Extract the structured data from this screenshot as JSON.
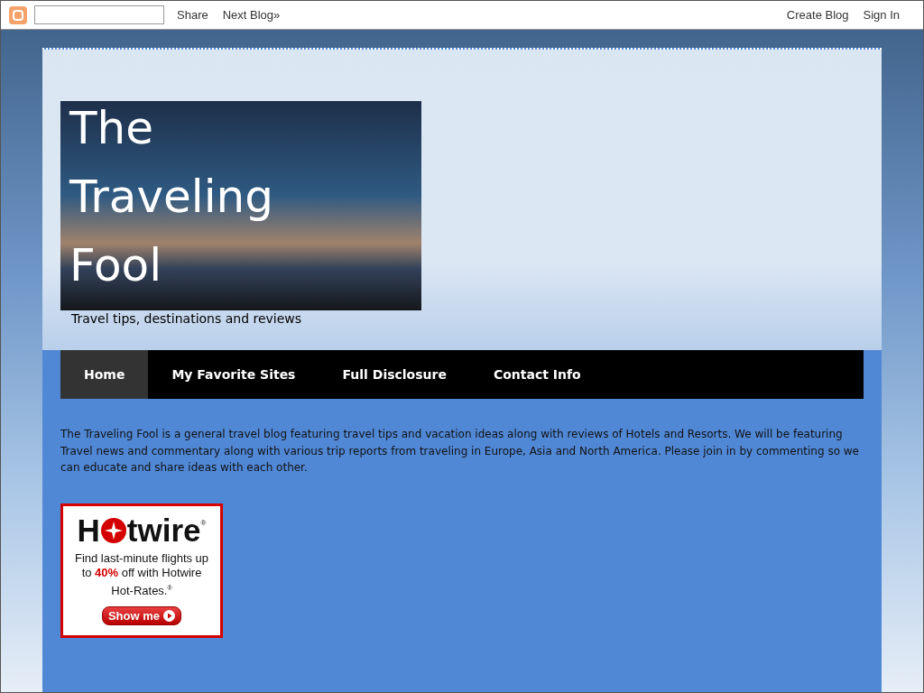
{
  "navbar": {
    "links": [
      "Share",
      "Next Blog»"
    ],
    "account_links": [
      "Create Blog",
      "Sign In"
    ]
  },
  "blog": {
    "title_lines": [
      "The",
      "Traveling",
      "Fool"
    ],
    "tagline": "Travel tips, destinations and reviews"
  },
  "tabs": [
    {
      "label": "Home",
      "selected": true
    },
    {
      "label": "My Favorite Sites",
      "selected": false
    },
    {
      "label": "Full Disclosure",
      "selected": false
    },
    {
      "label": "Contact Info",
      "selected": false
    }
  ],
  "description": "The Traveling Fool is a general travel blog featuring travel tips and vacation ideas along with reviews of Hotels and Resorts. We will be featuring Travel news and commentary along with various trip reports from traveling in Europe, Asia and North America. Please join in by commenting so we can educate and share ideas with each other.",
  "ad": {
    "logo_start": "H",
    "logo_end": "twire",
    "registered": "®",
    "text": "Find last-minute flights up to **40%** off with Hotwire Hot-Rates.$^{®}$",
    "button": "Show me"
  }
}
